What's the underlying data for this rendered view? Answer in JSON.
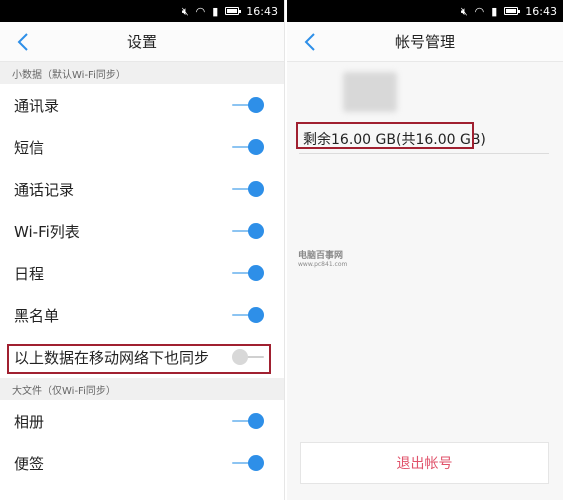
{
  "status_bar": {
    "time": "16:43",
    "icons": [
      "mute-icon",
      "wifi-icon",
      "signal-icon",
      "battery-icon"
    ]
  },
  "settings": {
    "title": "设置",
    "small_section_header": "小数据（默认Wi-Fi同步）",
    "small_items": [
      {
        "label": "通讯录",
        "enabled": true
      },
      {
        "label": "短信",
        "enabled": true
      },
      {
        "label": "通话记录",
        "enabled": true
      },
      {
        "label": "Wi-Fi列表",
        "enabled": true
      },
      {
        "label": "日程",
        "enabled": true
      },
      {
        "label": "黑名单",
        "enabled": true
      }
    ],
    "mobile_sync": {
      "label": "以上数据在移动网络下也同步",
      "enabled": false
    },
    "large_section_header": "大文件（仅Wi-Fi同步）",
    "large_items": [
      {
        "label": "相册",
        "enabled": true
      },
      {
        "label": "便签",
        "enabled": true
      }
    ]
  },
  "account": {
    "title": "帐号管理",
    "storage": "剩余16.00 GB(共16.00 GB)",
    "logout_label": "退出帐号"
  },
  "watermark": {
    "line1": "电脑百事网",
    "line2": "www.pc841.com"
  },
  "colors": {
    "accent": "#2e8fe8",
    "highlight": "#a02030",
    "logout": "#e0526a"
  }
}
